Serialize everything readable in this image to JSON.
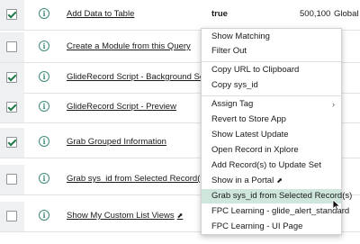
{
  "rows": [
    {
      "checked": true,
      "name": "Add Data to Table",
      "value": "true",
      "number": "500,100",
      "scope": "Global"
    },
    {
      "checked": false,
      "name": "Create a Module from this Query"
    },
    {
      "checked": true,
      "name": "GlideRecord Script - Background Script -"
    },
    {
      "checked": true,
      "name": "GlideRecord Script - Preview"
    },
    {
      "checked": true,
      "name": "Grab Grouped Information"
    },
    {
      "checked": false,
      "name": "Grab sys_id from Selected Record(s)"
    },
    {
      "checked": false,
      "name": "Show My Custom List Views"
    }
  ],
  "info_glyph": "i",
  "context_menu": {
    "group1": [
      "Show Matching",
      "Filter Out"
    ],
    "group2": [
      "Copy URL to Clipboard",
      "Copy sys_id"
    ],
    "group3": [
      "Assign Tag",
      "Revert to Store App",
      "Show Latest Update",
      "Open Record in Xplore",
      "Add Record(s) to Update Set",
      "Show in a Portal",
      "Grab sys_id from Selected Record(s)",
      "FPC Learning - glide_alert_standard",
      "FPC Learning - UI Page"
    ],
    "submenu_arrow": "›",
    "external_link_glyph": "⬈",
    "highlighted_item": "Grab sys_id from Selected Record(s)"
  },
  "colors": {
    "accent": "#3f8a7c",
    "highlight": "#cfe6dd",
    "checkbox_column": "#eef0f1"
  }
}
